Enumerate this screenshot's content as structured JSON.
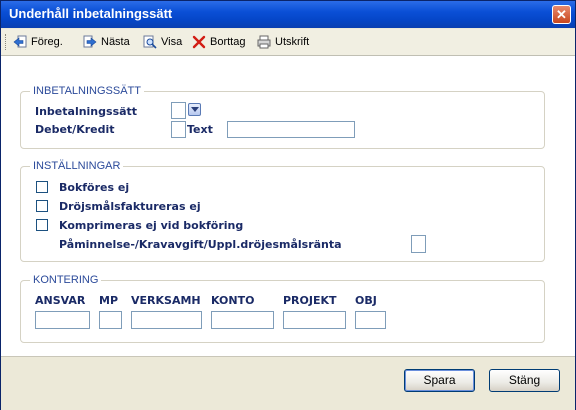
{
  "window": {
    "title": "Underhåll inbetalningssätt",
    "close_glyph": "✕"
  },
  "toolbar": {
    "buttons": [
      {
        "label": "Föreg.",
        "icon": "arrow-left-icon"
      },
      {
        "label": "Nästa",
        "icon": "arrow-right-icon"
      },
      {
        "label": "Visa",
        "icon": "magnifier-icon"
      },
      {
        "label": "Borttag",
        "icon": "red-x-icon"
      },
      {
        "label": "Utskrift",
        "icon": "printer-icon"
      }
    ]
  },
  "group_inbetalning": {
    "legend": "INBETALNINGSSÄTT",
    "inbetalningssatt_label": "Inbetalningssätt",
    "inbetalningssatt_value": "",
    "debet_kredit_label": "Debet/Kredit",
    "debet_kredit_value": "",
    "text_label": "Text",
    "text_value": ""
  },
  "group_installningar": {
    "legend": "INSTÄLLNINGAR",
    "options": [
      {
        "label": "Bokföres ej",
        "checked": false
      },
      {
        "label": "Dröjsmålsfaktureras ej",
        "checked": false
      },
      {
        "label": "Komprimeras ej vid bokföring",
        "checked": false
      }
    ],
    "paminnelse_label": "Påminnelse-/Kravavgift/Uppl.dröjesmålsränta",
    "paminnelse_value": ""
  },
  "group_kontering": {
    "legend": "KONTERING",
    "fields": [
      {
        "label": "ANSVAR",
        "value": ""
      },
      {
        "label": "MP",
        "value": ""
      },
      {
        "label": "VERKSAMH",
        "value": ""
      },
      {
        "label": "KONTO",
        "value": ""
      },
      {
        "label": "PROJEKT",
        "value": ""
      },
      {
        "label": "OBJ",
        "value": ""
      }
    ]
  },
  "footer": {
    "save_label": "Spara",
    "close_label": "Stäng"
  },
  "colors": {
    "titlebar": "#0a4fd6",
    "legend_text": "#2b4a9a",
    "label_text": "#1a2a66"
  }
}
